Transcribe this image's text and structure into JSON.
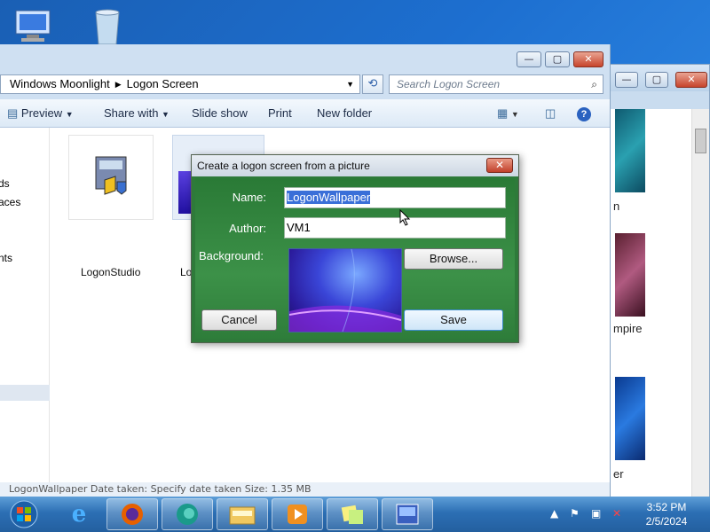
{
  "explorer": {
    "breadcrumb": [
      "Windows Moonlight",
      "Logon Screen"
    ],
    "search_placeholder": "Search Logon Screen",
    "toolbar": {
      "preview": "Preview",
      "share_with": "Share with",
      "slide_show": "Slide show",
      "print": "Print",
      "new_folder": "New folder"
    },
    "nav_items": [
      "ds",
      "aces",
      "nts"
    ],
    "files": [
      {
        "name": "LogonStudio"
      },
      {
        "name": "Lo"
      }
    ],
    "status_text": "LogonWallpaper   Date taken: Specify date taken          Size: 1.35 MB"
  },
  "back_window": {
    "labels": [
      "n",
      "mpire",
      "er"
    ]
  },
  "dialog": {
    "title": "Create a logon screen from a picture",
    "name_label": "Name:",
    "name_value": "LogonWallpaper",
    "author_label": "Author:",
    "author_value": "VM1",
    "background_label": "Background:",
    "browse_label": "Browse...",
    "cancel_label": "Cancel",
    "save_label": "Save",
    "close_icon": "close-icon"
  },
  "taskbar": {
    "time": "3:52 PM",
    "date": "2/5/2024"
  },
  "colors": {
    "dialog_green": "#2e7a3a",
    "taskbar": "#2c6fb4",
    "desktop": "#1d6fd0",
    "selection": "#3a6fd8"
  }
}
